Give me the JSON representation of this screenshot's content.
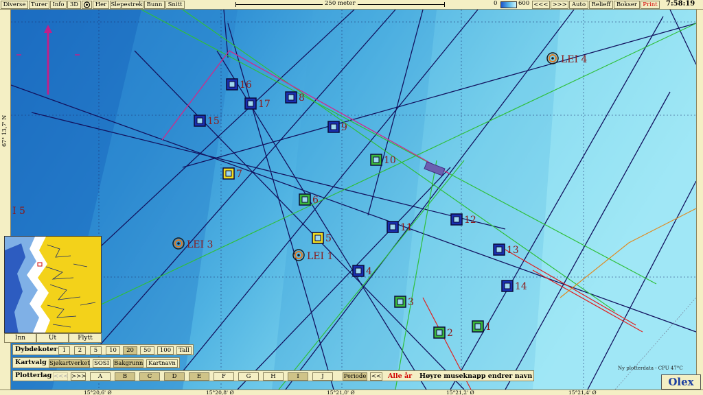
{
  "toolbar": {
    "buttons": [
      {
        "label": "Diverse"
      },
      {
        "label": "Turer"
      },
      {
        "label": "Info"
      },
      {
        "label": "3D"
      },
      {
        "label": ""
      },
      {
        "label": "Her"
      },
      {
        "label": "Slepestrek"
      },
      {
        "label": "Bunn"
      },
      {
        "label": "Snitt"
      }
    ],
    "scale_label": "250 meter",
    "depth_min": "0",
    "depth_max": "600",
    "right_buttons": [
      {
        "label": "<<<"
      },
      {
        "label": ">>>"
      },
      {
        "label": "Auto"
      },
      {
        "label": "Relieff"
      },
      {
        "label": "Bokser"
      },
      {
        "label": "Print"
      }
    ],
    "clock": "7:58:19"
  },
  "coordinates": {
    "latitude": "67° 13,7' N",
    "longitudes": [
      "15°20,6' Ø",
      "15°20,8' Ø",
      "15°21,0' Ø",
      "15°21,2' Ø",
      "15°21,4' Ø"
    ]
  },
  "map": {
    "side_label": "I 5",
    "waypoints": [
      {
        "label": "16",
        "color": "blue"
      },
      {
        "label": "17",
        "color": "blue"
      },
      {
        "label": "8",
        "color": "blue"
      },
      {
        "label": "15",
        "color": "blue"
      },
      {
        "label": "9",
        "color": "blue"
      },
      {
        "label": "10",
        "color": "green"
      },
      {
        "label": "7",
        "color": "yellow"
      },
      {
        "label": "6",
        "color": "green"
      },
      {
        "label": "11",
        "color": "blue"
      },
      {
        "label": "12",
        "color": "blue"
      },
      {
        "label": "5",
        "color": "yellow"
      },
      {
        "label": "13",
        "color": "blue"
      },
      {
        "label": "4",
        "color": "blue"
      },
      {
        "label": "14",
        "color": "blue"
      },
      {
        "label": "3",
        "color": "green"
      },
      {
        "label": "1",
        "color": "green"
      },
      {
        "label": "2",
        "color": "green"
      }
    ],
    "marks": [
      {
        "label": "LEI 4"
      },
      {
        "label": "LEI 3"
      },
      {
        "label": "LEI 1"
      }
    ]
  },
  "minimap": {
    "buttons": [
      {
        "label": "Inn"
      },
      {
        "label": "Ut"
      },
      {
        "label": "Flytt"
      }
    ]
  },
  "panel": {
    "dybdekoter": {
      "label": "Dybdekoter",
      "options": [
        {
          "label": "1"
        },
        {
          "label": "2"
        },
        {
          "label": "5"
        },
        {
          "label": "10"
        },
        {
          "label": "20"
        },
        {
          "label": "50"
        },
        {
          "label": "100"
        },
        {
          "label": "Tall"
        }
      ],
      "selected": "20"
    },
    "kartvalg": {
      "label": "Kartvalg",
      "options": [
        {
          "label": "Sjøkartverket"
        },
        {
          "label": "SOSI"
        },
        {
          "label": "Bakgrunn"
        },
        {
          "label": "Kartnavn"
        }
      ]
    },
    "plotterlag": {
      "label": "Plotterlag",
      "nav": [
        {
          "label": "<<<"
        },
        {
          "label": ">>>"
        }
      ],
      "layers": [
        {
          "label": "A"
        },
        {
          "label": "B"
        },
        {
          "label": "C"
        },
        {
          "label": "D"
        },
        {
          "label": "E"
        },
        {
          "label": "F"
        },
        {
          "label": "G"
        },
        {
          "label": "H"
        },
        {
          "label": "I"
        },
        {
          "label": "J"
        }
      ],
      "periode": "Periode",
      "prev": "<<",
      "alle_ar": "Alle år",
      "hint": "Høyre museknapp endrer navn"
    }
  },
  "status": "Ny plotterdata - CPU 47°C",
  "logo": "Olex"
}
